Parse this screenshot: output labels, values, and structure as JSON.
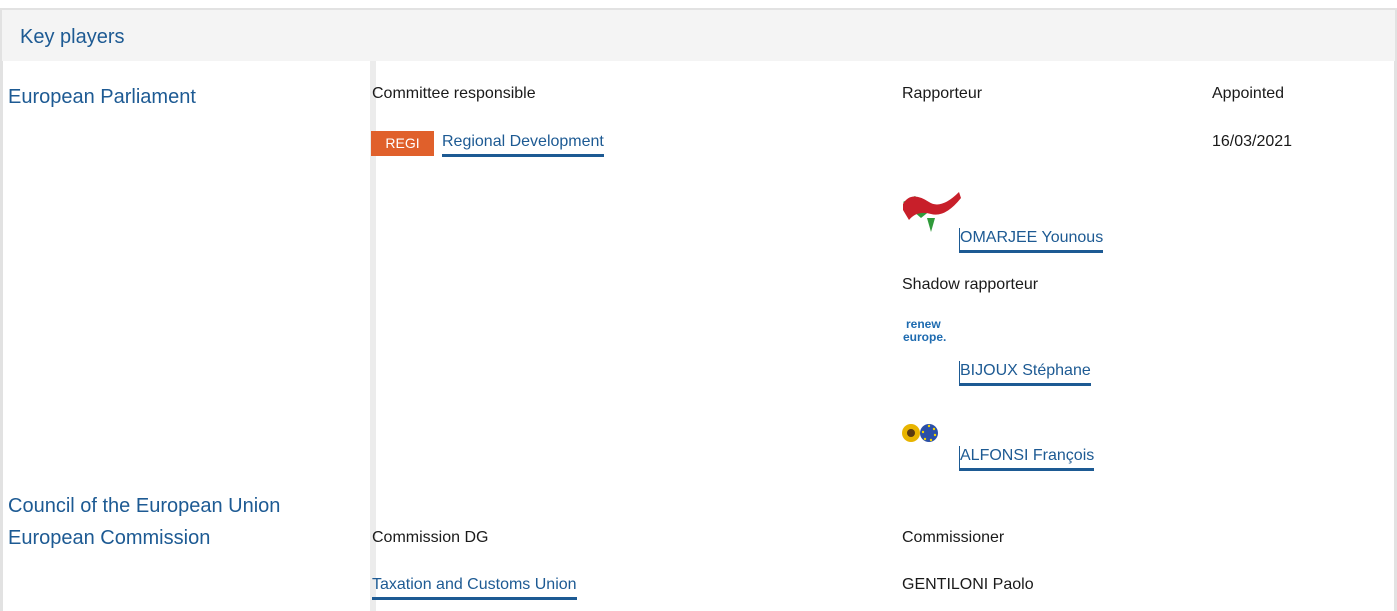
{
  "section": {
    "title": "Key players"
  },
  "institutions": {
    "parliament": "European Parliament",
    "council": "Council of the European Union",
    "commission": "European Commission"
  },
  "parliament": {
    "committee_header": "Committee responsible",
    "rapporteur_header": "Rapporteur",
    "appointed_header": "Appointed",
    "committee_badge": "REGI",
    "committee_name": "Regional Development",
    "appointed_date": "16/03/2021",
    "rapporteur": {
      "name": "OMARJEE Younous",
      "logo_icon": "left-group-logo-icon"
    },
    "shadow_header": "Shadow rapporteur",
    "shadows": [
      {
        "name": "BIJOUX Stéphane",
        "logo_text_1": "renew",
        "logo_text_2": "europe.",
        "logo_icon": "renew-europe-logo-icon"
      },
      {
        "name": "ALFONSI François",
        "logo_icon": "greens-efa-logo-icon"
      }
    ]
  },
  "commission": {
    "dg_header": "Commission DG",
    "commissioner_header": "Commissioner",
    "dg_name": "Taxation and Customs Union",
    "commissioner_name": "GENTILONI Paolo"
  },
  "colors": {
    "link": "#1d5a93",
    "badge": "#e0602b",
    "header_bg": "#f4f4f4",
    "border": "#e2e2e2"
  }
}
